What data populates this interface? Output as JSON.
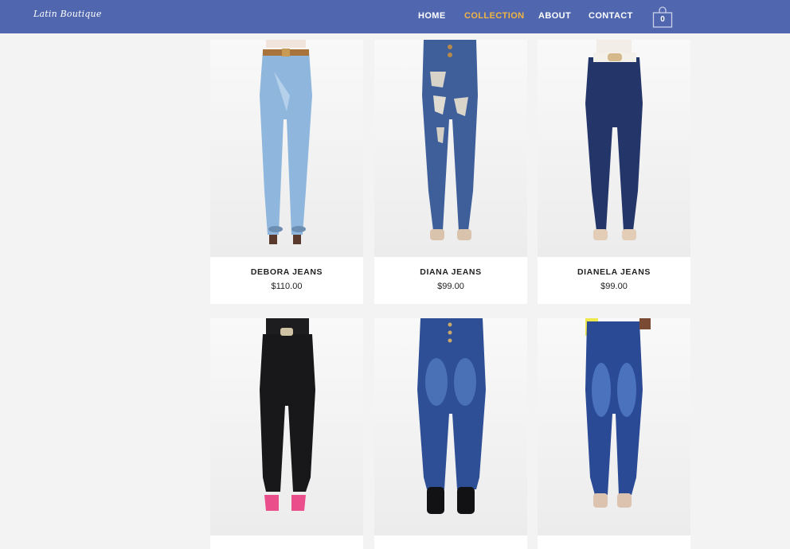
{
  "brand": {
    "logo_text": "Latin Boutique"
  },
  "nav": {
    "items": [
      {
        "label": "HOME",
        "active": false
      },
      {
        "label": "COLLECTION",
        "active": true
      },
      {
        "label": "ABOUT",
        "active": false
      },
      {
        "label": "CONTACT",
        "active": false
      }
    ],
    "cart_count": "0",
    "cart_icon": "shopping-bag-icon"
  },
  "colors": {
    "header_bg": "#5067af",
    "active_link": "#f3b53f",
    "page_bg": "#f3f3f3"
  },
  "products": [
    {
      "name": "DEBORA JEANS",
      "price": "$110.00",
      "denim": "light-wash",
      "image_icon": "light-jeans-photo"
    },
    {
      "name": "DIANA JEANS",
      "price": "$99.00",
      "denim": "distressed-medium-wash",
      "image_icon": "ripped-jeans-photo"
    },
    {
      "name": "DIANELA JEANS",
      "price": "$99.00",
      "denim": "dark-wash",
      "image_icon": "dark-jeans-photo"
    },
    {
      "name": "",
      "price": "",
      "denim": "black",
      "image_icon": "black-jeans-photo"
    },
    {
      "name": "",
      "price": "",
      "denim": "medium-wash",
      "image_icon": "blue-jeans-photo"
    },
    {
      "name": "",
      "price": "",
      "denim": "medium-wash",
      "image_icon": "blue-jeans-photo"
    }
  ]
}
